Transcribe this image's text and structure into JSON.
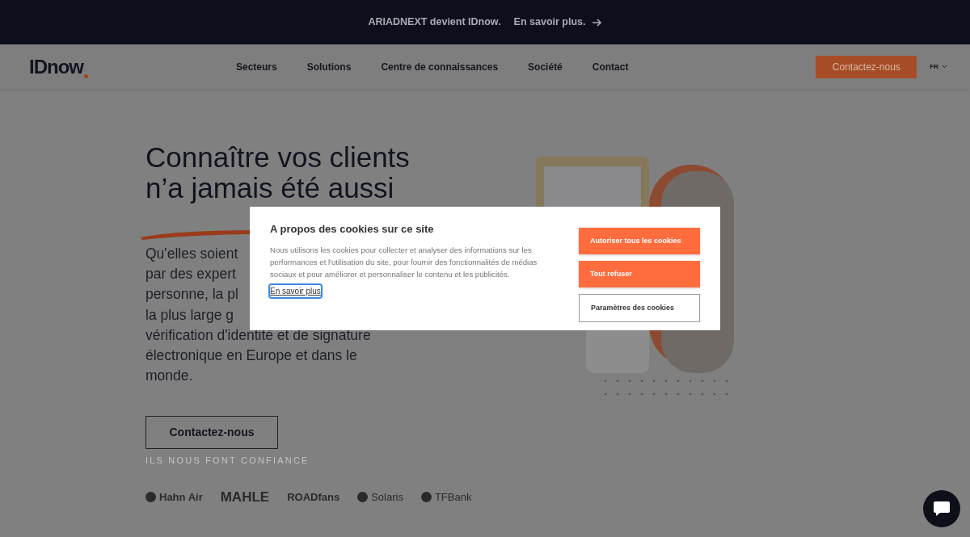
{
  "announcement": {
    "text": "ARIADNEXT devient IDnow.",
    "link": "En savoir plus."
  },
  "header": {
    "logo": "IDnow",
    "nav": [
      "Secteurs",
      "Solutions",
      "Centre de connaissances",
      "Société",
      "Contact"
    ],
    "cta": "Contactez-nous",
    "language": "FR"
  },
  "hero": {
    "heading_lines": [
      "Connaître vos clients",
      "n’a jamais été aussi"
    ],
    "paragraph_lines": [
      "Qu'elles soient",
      "par des expert",
      "personne, la pl",
      "la plus large g",
      "vérification d'identité et de signature",
      "électronique en Europe et dans le",
      "monde."
    ],
    "button": "Contactez-nous",
    "trust_label": "ILS NOUS FONT CONFIANCE",
    "logos": [
      "Hahn Air",
      "MAHLE",
      "ROADfans",
      "Solaris",
      "TFBank"
    ]
  },
  "cookie_dialog": {
    "title": "A propos des cookies sur ce site",
    "text": "Nous utilisons les cookies pour collecter et analyser des informations sur les performances et l'utilisation du site, pour fournir des fonctionnalités de médias sociaux et pour améliorer et personnaliser le contenu et les publicités.",
    "link": "En savoir plus",
    "buttons": [
      {
        "label": "Autoriser tous les cookies",
        "kind": "filled"
      },
      {
        "label": "Tout refuser",
        "kind": "filled"
      },
      {
        "label": "Paramètres des cookies",
        "kind": "outline"
      }
    ]
  }
}
